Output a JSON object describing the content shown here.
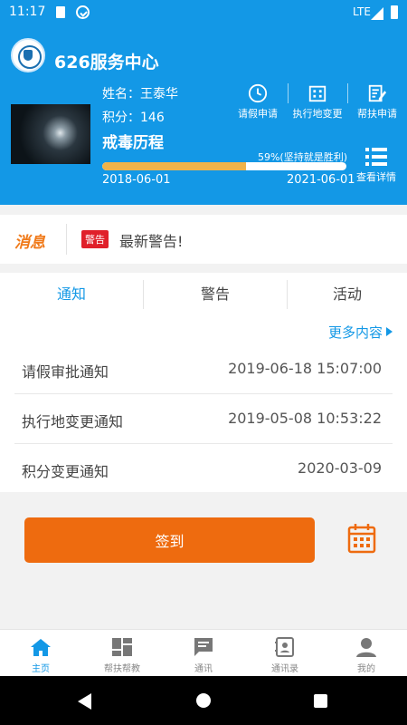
{
  "status_bar": {
    "time": "11:17",
    "network": "LTE"
  },
  "header": {
    "title": "626服务中心",
    "name_line": "姓名：王泰华",
    "points_line": "积分：146",
    "journey_title": "戒毒历程",
    "progress_label": "59%(坚持就是胜利)",
    "progress_fraction": 0.59,
    "start_date": "2018-06-01",
    "end_date": "2021-06-01",
    "actions": [
      {
        "label": "请假申请",
        "icon": "clock-icon"
      },
      {
        "label": "执行地变更",
        "icon": "building-icon"
      },
      {
        "label": "帮扶申请",
        "icon": "edit-document-icon"
      }
    ],
    "details_label": "查看详情"
  },
  "message_bar": {
    "logo_text": "消息",
    "badge": "警告",
    "text": "最新警告!"
  },
  "tabs": [
    {
      "label": "通知",
      "active": true
    },
    {
      "label": "警告",
      "active": false
    },
    {
      "label": "活动",
      "active": false
    }
  ],
  "more_label": "更多内容",
  "notices": [
    {
      "title": "请假审批通知",
      "date": "2019-06-18 15:07:00"
    },
    {
      "title": "执行地变更通知",
      "date": "2019-05-08 10:53:22"
    },
    {
      "title": "积分变更通知",
      "date": "2020-03-09"
    }
  ],
  "checkin_label": "签到",
  "bottom_nav": [
    {
      "label": "主页",
      "icon": "home-icon",
      "active": true
    },
    {
      "label": "帮扶帮教",
      "icon": "dashboard-icon",
      "active": false
    },
    {
      "label": "通讯",
      "icon": "chat-icon",
      "active": false
    },
    {
      "label": "通讯录",
      "icon": "contacts-icon",
      "active": false
    },
    {
      "label": "我的",
      "icon": "person-icon",
      "active": false
    }
  ],
  "colors": {
    "primary": "#1398e6",
    "accent": "#ee6b0f",
    "progress": "#f0b34a",
    "warning": "#e0202a"
  }
}
